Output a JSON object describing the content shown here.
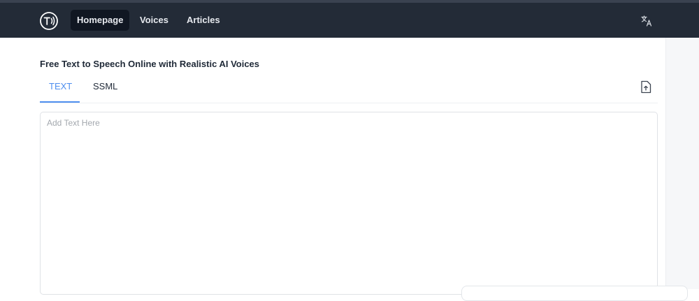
{
  "nav": {
    "logo_icon": "text-to-speech-logo-icon",
    "items": [
      {
        "label": "Homepage",
        "active": true
      },
      {
        "label": "Voices",
        "active": false
      },
      {
        "label": "Articles",
        "active": false
      }
    ],
    "language_icon": "translate-icon"
  },
  "main": {
    "title": "Free Text to Speech Online with Realistic AI Voices",
    "tabs": [
      {
        "label": "TEXT",
        "active": true
      },
      {
        "label": "SSML",
        "active": false
      }
    ],
    "upload_icon": "file-upload-icon",
    "editor": {
      "placeholder": "Add Text Here",
      "value": ""
    }
  },
  "colors": {
    "navbar": "#232b37",
    "nav_active": "#101722",
    "accent": "#4f8fef",
    "text": "#1f2937"
  }
}
